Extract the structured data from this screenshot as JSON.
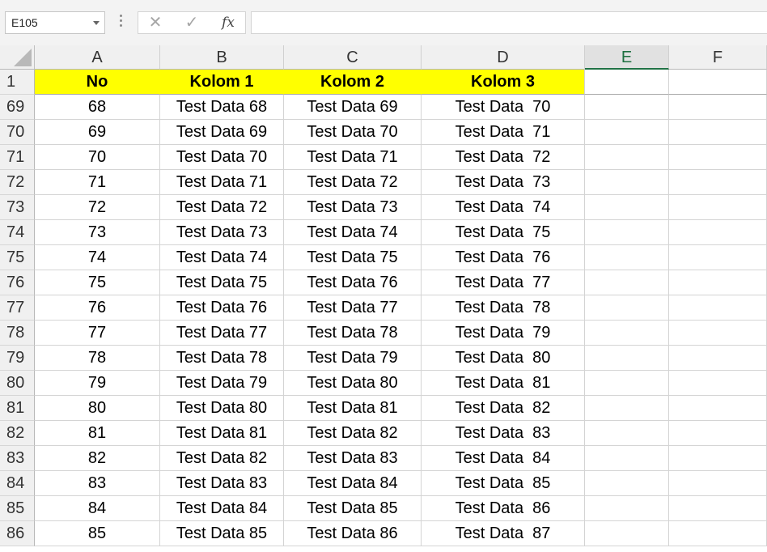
{
  "formula_bar": {
    "name_box": "E105",
    "cancel_icon": "✕",
    "enter_icon": "✓",
    "fx_label": "fx",
    "formula_value": ""
  },
  "columns": [
    "A",
    "B",
    "C",
    "D",
    "E",
    "F"
  ],
  "selected_column": "E",
  "header_row": {
    "row_number": "1",
    "cells": [
      "No",
      "Kolom 1",
      "Kolom 2",
      "Kolom 3"
    ]
  },
  "rows": [
    {
      "num": "69",
      "cells": [
        "68",
        "Test Data 68",
        "Test Data 69",
        "Test Data  70"
      ]
    },
    {
      "num": "70",
      "cells": [
        "69",
        "Test Data 69",
        "Test Data 70",
        "Test Data  71"
      ]
    },
    {
      "num": "71",
      "cells": [
        "70",
        "Test Data 70",
        "Test Data 71",
        "Test Data  72"
      ]
    },
    {
      "num": "72",
      "cells": [
        "71",
        "Test Data 71",
        "Test Data 72",
        "Test Data  73"
      ]
    },
    {
      "num": "73",
      "cells": [
        "72",
        "Test Data 72",
        "Test Data 73",
        "Test Data  74"
      ]
    },
    {
      "num": "74",
      "cells": [
        "73",
        "Test Data 73",
        "Test Data 74",
        "Test Data  75"
      ]
    },
    {
      "num": "75",
      "cells": [
        "74",
        "Test Data 74",
        "Test Data 75",
        "Test Data  76"
      ]
    },
    {
      "num": "76",
      "cells": [
        "75",
        "Test Data 75",
        "Test Data 76",
        "Test Data  77"
      ]
    },
    {
      "num": "77",
      "cells": [
        "76",
        "Test Data 76",
        "Test Data 77",
        "Test Data  78"
      ]
    },
    {
      "num": "78",
      "cells": [
        "77",
        "Test Data 77",
        "Test Data 78",
        "Test Data  79"
      ]
    },
    {
      "num": "79",
      "cells": [
        "78",
        "Test Data 78",
        "Test Data 79",
        "Test Data  80"
      ]
    },
    {
      "num": "80",
      "cells": [
        "79",
        "Test Data 79",
        "Test Data 80",
        "Test Data  81"
      ]
    },
    {
      "num": "81",
      "cells": [
        "80",
        "Test Data 80",
        "Test Data 81",
        "Test Data  82"
      ]
    },
    {
      "num": "82",
      "cells": [
        "81",
        "Test Data 81",
        "Test Data 82",
        "Test Data  83"
      ]
    },
    {
      "num": "83",
      "cells": [
        "82",
        "Test Data 82",
        "Test Data 83",
        "Test Data  84"
      ]
    },
    {
      "num": "84",
      "cells": [
        "83",
        "Test Data 83",
        "Test Data 84",
        "Test Data  85"
      ]
    },
    {
      "num": "85",
      "cells": [
        "84",
        "Test Data 84",
        "Test Data 85",
        "Test Data  86"
      ]
    },
    {
      "num": "86",
      "cells": [
        "85",
        "Test Data 85",
        "Test Data 86",
        "Test Data  87"
      ]
    }
  ],
  "colors": {
    "header_fill": "#ffff00",
    "selected_column_accent": "#217346"
  }
}
